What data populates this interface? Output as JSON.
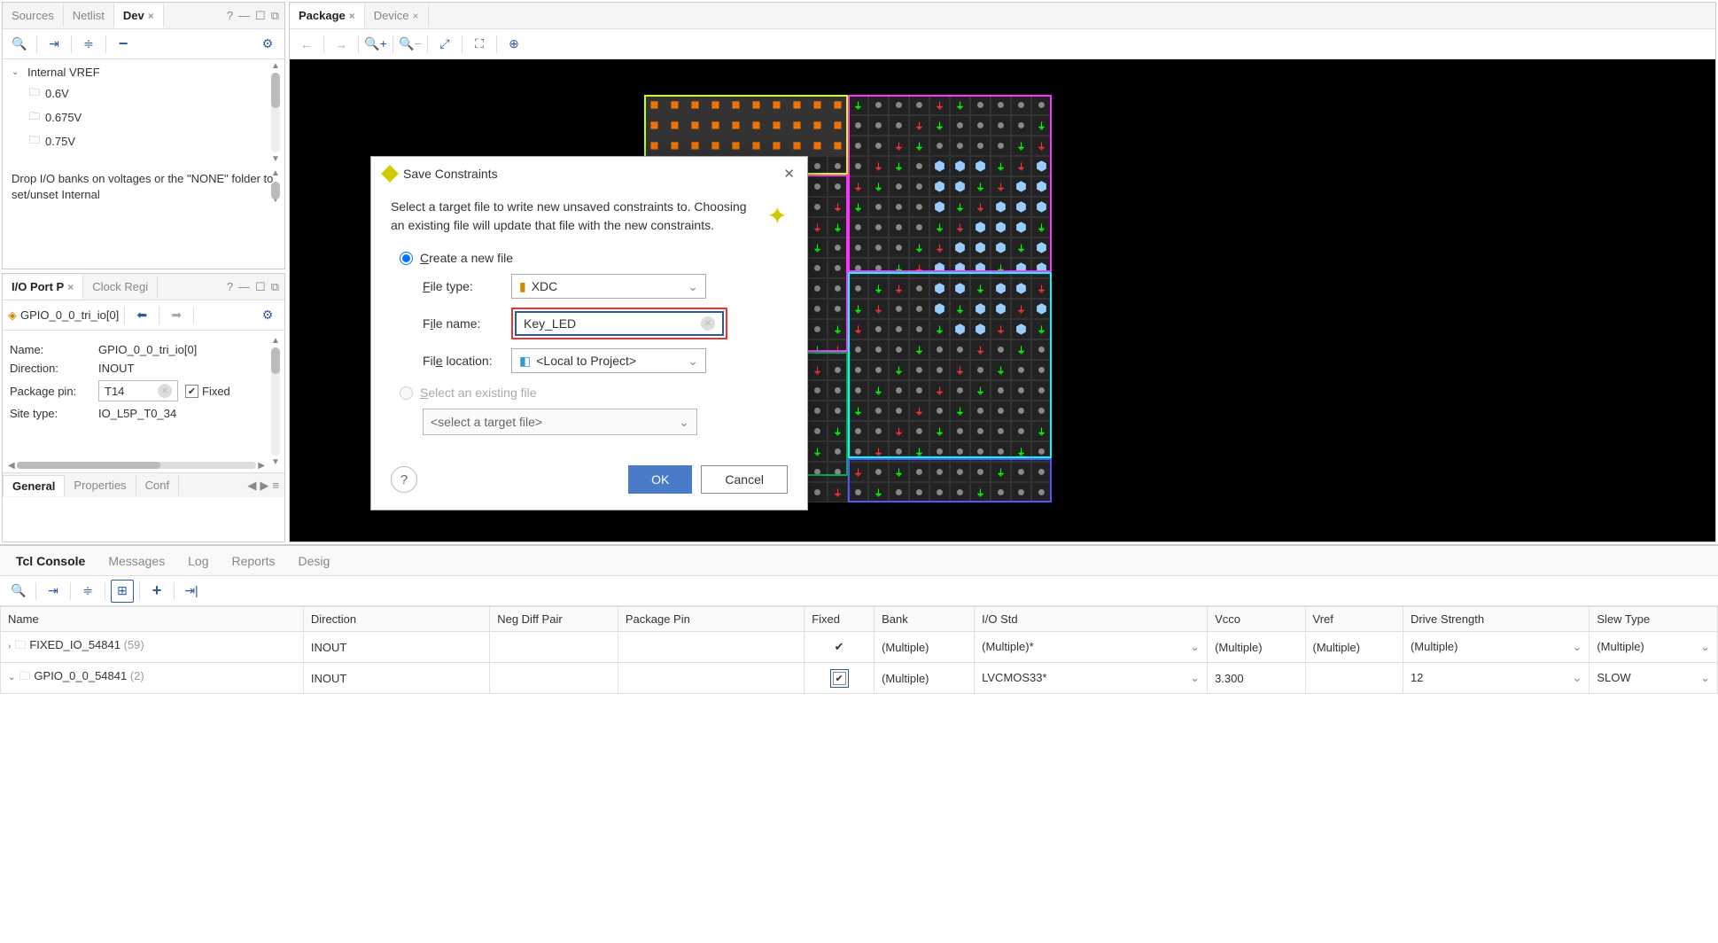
{
  "left_top_panel": {
    "tabs": [
      "Sources",
      "Netlist",
      "Dev"
    ],
    "active_tab": 2,
    "tree": {
      "root": "Internal VREF",
      "items": [
        "0.6V",
        "0.675V",
        "0.75V"
      ]
    },
    "hint": "Drop I/O banks on voltages or the \"NONE\" folder to set/unset Internal"
  },
  "left_bottom_panel": {
    "tabs": [
      "I/O Port P",
      "Clock Regi"
    ],
    "active_tab": 0,
    "breadcrumb": "GPIO_0_0_tri_io[0]",
    "props": {
      "name_label": "Name:",
      "name_value": "GPIO_0_0_tri_io[0]",
      "direction_label": "Direction:",
      "direction_value": "INOUT",
      "package_pin_label": "Package pin:",
      "package_pin_value": "T14",
      "fixed_label": "Fixed",
      "site_type_label": "Site type:",
      "site_type_value": "IO_L5P_T0_34"
    },
    "bottom_tabs": [
      "General",
      "Properties",
      "Conf"
    ]
  },
  "package_panel": {
    "tabs": [
      "Package",
      "Device"
    ],
    "active_tab": 0
  },
  "dialog": {
    "title": "Save Constraints",
    "description": "Select a target file to write new unsaved constraints to. Choosing an existing file will update that file with the new constraints.",
    "radio_create": "Create a new file",
    "radio_select": "Select an existing file",
    "file_type_label": "File type:",
    "file_type_value": "XDC",
    "file_name_label": "File name:",
    "file_name_value": "Key_LED",
    "file_location_label": "File location:",
    "file_location_value": "<Local to Project>",
    "select_placeholder": "<select a target file>",
    "ok": "OK",
    "cancel": "Cancel"
  },
  "console": {
    "tabs": [
      "Tcl Console",
      "Messages",
      "Log",
      "Reports",
      "Desig"
    ],
    "active_tab": 0
  },
  "io_table": {
    "columns": [
      "Name",
      "Direction",
      "Neg Diff Pair",
      "Package Pin",
      "Fixed",
      "Bank",
      "I/O Std",
      "Vcco",
      "Vref",
      "Drive Strength",
      "Slew Type"
    ],
    "rows": [
      {
        "expand": ">",
        "name": "FIXED_IO_54841",
        "count": "(59)",
        "direction": "INOUT",
        "neg_diff_pair": "",
        "package_pin": "",
        "fixed": "✔",
        "bank": "(Multiple)",
        "io_std": "(Multiple)*",
        "vcco": "(Multiple)",
        "vref": "(Multiple)",
        "drive_strength": "(Multiple)",
        "slew_type": "(Multiple)"
      },
      {
        "expand": "v",
        "name": "GPIO_0_0_54841",
        "count": "(2)",
        "direction": "INOUT",
        "neg_diff_pair": "",
        "package_pin": "",
        "fixed": "checkbox-checked",
        "bank": "(Multiple)",
        "io_std": "LVCMOS33*",
        "vcco": "3.300",
        "vref": "",
        "drive_strength": "12",
        "slew_type": "SLOW"
      }
    ]
  }
}
